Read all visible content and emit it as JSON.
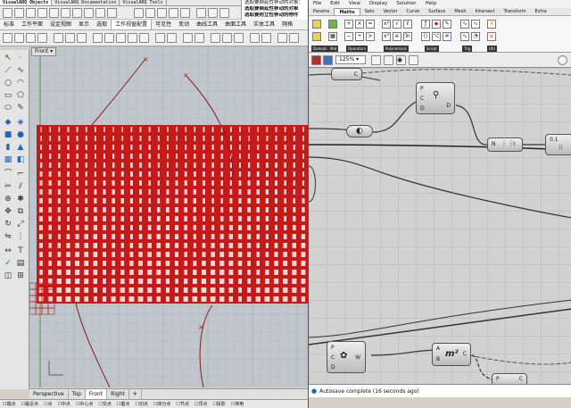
{
  "rhino": {
    "panel_tabs": [
      "VisualARQ Objects",
      "VisualARQ Documentation",
      "VisualARQ Tools"
    ],
    "command_lines": [
      "选取要倒延性移动的对象：",
      "选取要倒延性移动的对象",
      "选取要附立性移动的物件"
    ],
    "menu_tabs": [
      "标准",
      "工作平面",
      "设定视图",
      "显示",
      "选取",
      "工作视窗配置",
      "可见性",
      "变动",
      "曲线工具",
      "曲面工具",
      "实体工具",
      "网格"
    ],
    "active_menu_tab": "工作视窗配置",
    "viewport_label": "Front",
    "viewport_tabs": [
      "Perspective",
      "Top",
      "Front",
      "Right"
    ],
    "active_viewport_tab": "Front",
    "add_tab_icon": "plus-icon",
    "osnaps": [
      "端点",
      "最近点",
      "点",
      "中点",
      "中心点",
      "交点",
      "垂点",
      "切点",
      "四分点",
      "节点",
      "顶点",
      "投影",
      "停用"
    ]
  },
  "gh": {
    "menu": [
      "File",
      "Edit",
      "View",
      "Display",
      "Solution",
      "Help"
    ],
    "tabs": [
      "Params",
      "Maths",
      "Sets",
      "Vector",
      "Curve",
      "Surface",
      "Mesh",
      "Intersect",
      "Transform",
      "Extra"
    ],
    "active_tab": "Maths",
    "ribbon_groups": [
      "Domain",
      "Mat",
      "Operators",
      "Polynomials",
      "Script",
      "Trig",
      "Util"
    ],
    "zoom": "125%",
    "status": "Autosave complete (16 seconds ago)",
    "nodes": {
      "top_node_port": "C",
      "merge_ports": [
        "P",
        "C",
        "D"
      ],
      "merge_out": "D",
      "numlist_ports": [
        "N",
        "I"
      ],
      "dots": "0.1",
      "bottom_ports": [
        "P",
        "C",
        "D"
      ],
      "bottom_out": "W",
      "expr_label": "m²",
      "expr_ports": [
        "A",
        "B"
      ],
      "expr_out": "C",
      "last_ports": [
        "P",
        "C"
      ]
    }
  }
}
